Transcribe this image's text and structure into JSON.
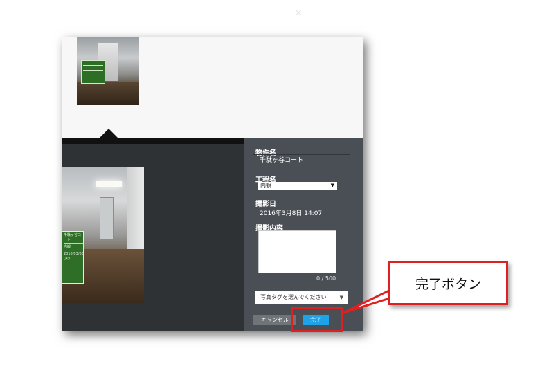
{
  "top_thumbnail": {
    "board_lines": 4
  },
  "photo_board": {
    "rows": [
      "千駄ヶ谷コート",
      "内観",
      "2016/03/08 (火)"
    ]
  },
  "form": {
    "property_label": "物件名",
    "property_value": "千駄ヶ谷コート",
    "process_label": "工程名",
    "process_value": "内観",
    "date_label": "撮影日",
    "date_value": "2016年3月8日 14:07",
    "content_label": "撮影内容",
    "content_value": "",
    "counter": "0 / 500",
    "tag_placeholder": "写真タグを選んでください",
    "close_icon": "×"
  },
  "buttons": {
    "cancel_label": "キャンセル",
    "done_label": "完了"
  },
  "annotation": {
    "callout_text": "完了ボタン",
    "accent_color": "#e02020"
  },
  "colors": {
    "panel_bg": "#4a4f55",
    "done_button": "#1fa3e8",
    "cancel_button": "#6f7479"
  }
}
